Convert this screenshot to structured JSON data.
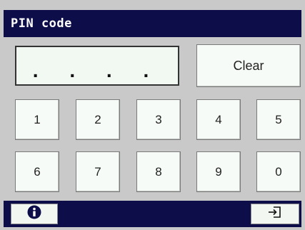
{
  "title": "PIN code",
  "pin_display": ". . . .",
  "clear_label": "Clear",
  "keys_row1": [
    "1",
    "2",
    "3",
    "4",
    "5"
  ],
  "keys_row2": [
    "6",
    "7",
    "8",
    "9",
    "0"
  ],
  "icons": {
    "info": "info-icon",
    "exit": "sign-in-exit-icon"
  },
  "colors": {
    "bar": "#0d0d4a",
    "key_bg": "#f7fbf7",
    "panel_bg": "#c9c9c9"
  }
}
